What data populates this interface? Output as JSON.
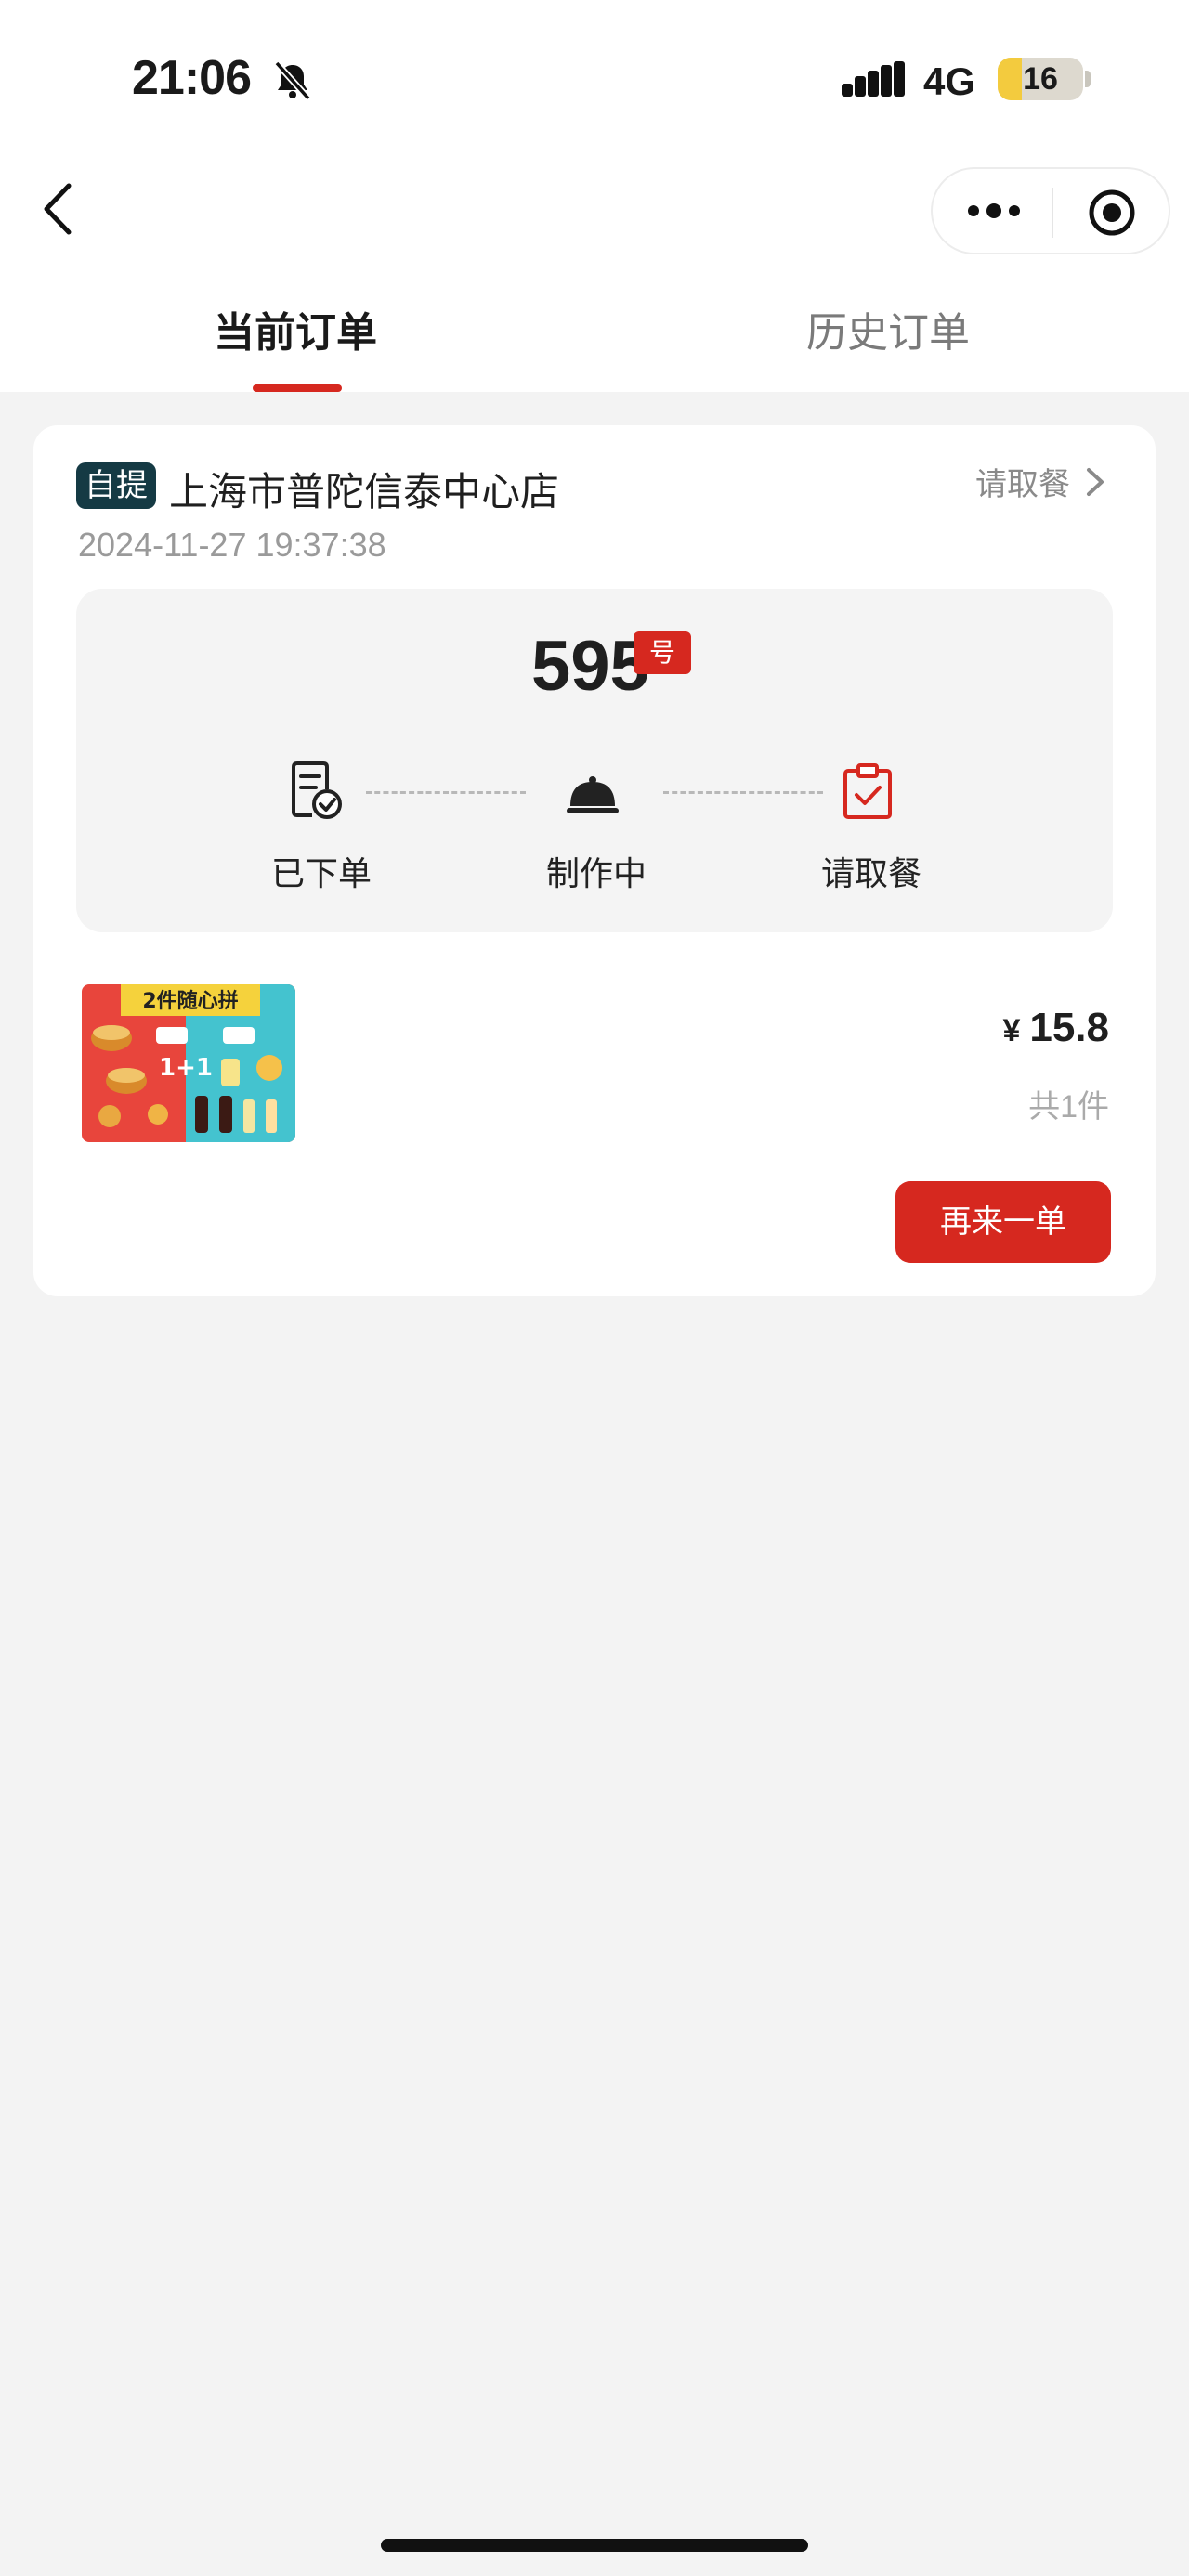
{
  "status_bar": {
    "time": "21:06",
    "network": "4G",
    "battery": "16"
  },
  "tabs": [
    {
      "label": "当前订单",
      "active": true
    },
    {
      "label": "历史订单",
      "active": false
    }
  ],
  "order": {
    "tag": "自提",
    "store": "上海市普陀信泰中心店",
    "datetime": "2024-11-27 19:37:38",
    "status_link": "请取餐",
    "pickup_number": "595",
    "number_suffix": "号",
    "steps": [
      {
        "label": "已下单",
        "icon": "order-placed-icon"
      },
      {
        "label": "制作中",
        "icon": "cloche-icon"
      },
      {
        "label": "请取餐",
        "icon": "clipboard-check-icon"
      }
    ],
    "item": {
      "image_title": "2件随心拼",
      "image_badge": "1+1",
      "currency": "¥",
      "price": "15.8",
      "quantity": "共1件"
    },
    "reorder_label": "再来一单"
  },
  "colors": {
    "accent": "#d6281f",
    "tag_bg": "#153a44",
    "page_bg": "#f3f3f3"
  }
}
